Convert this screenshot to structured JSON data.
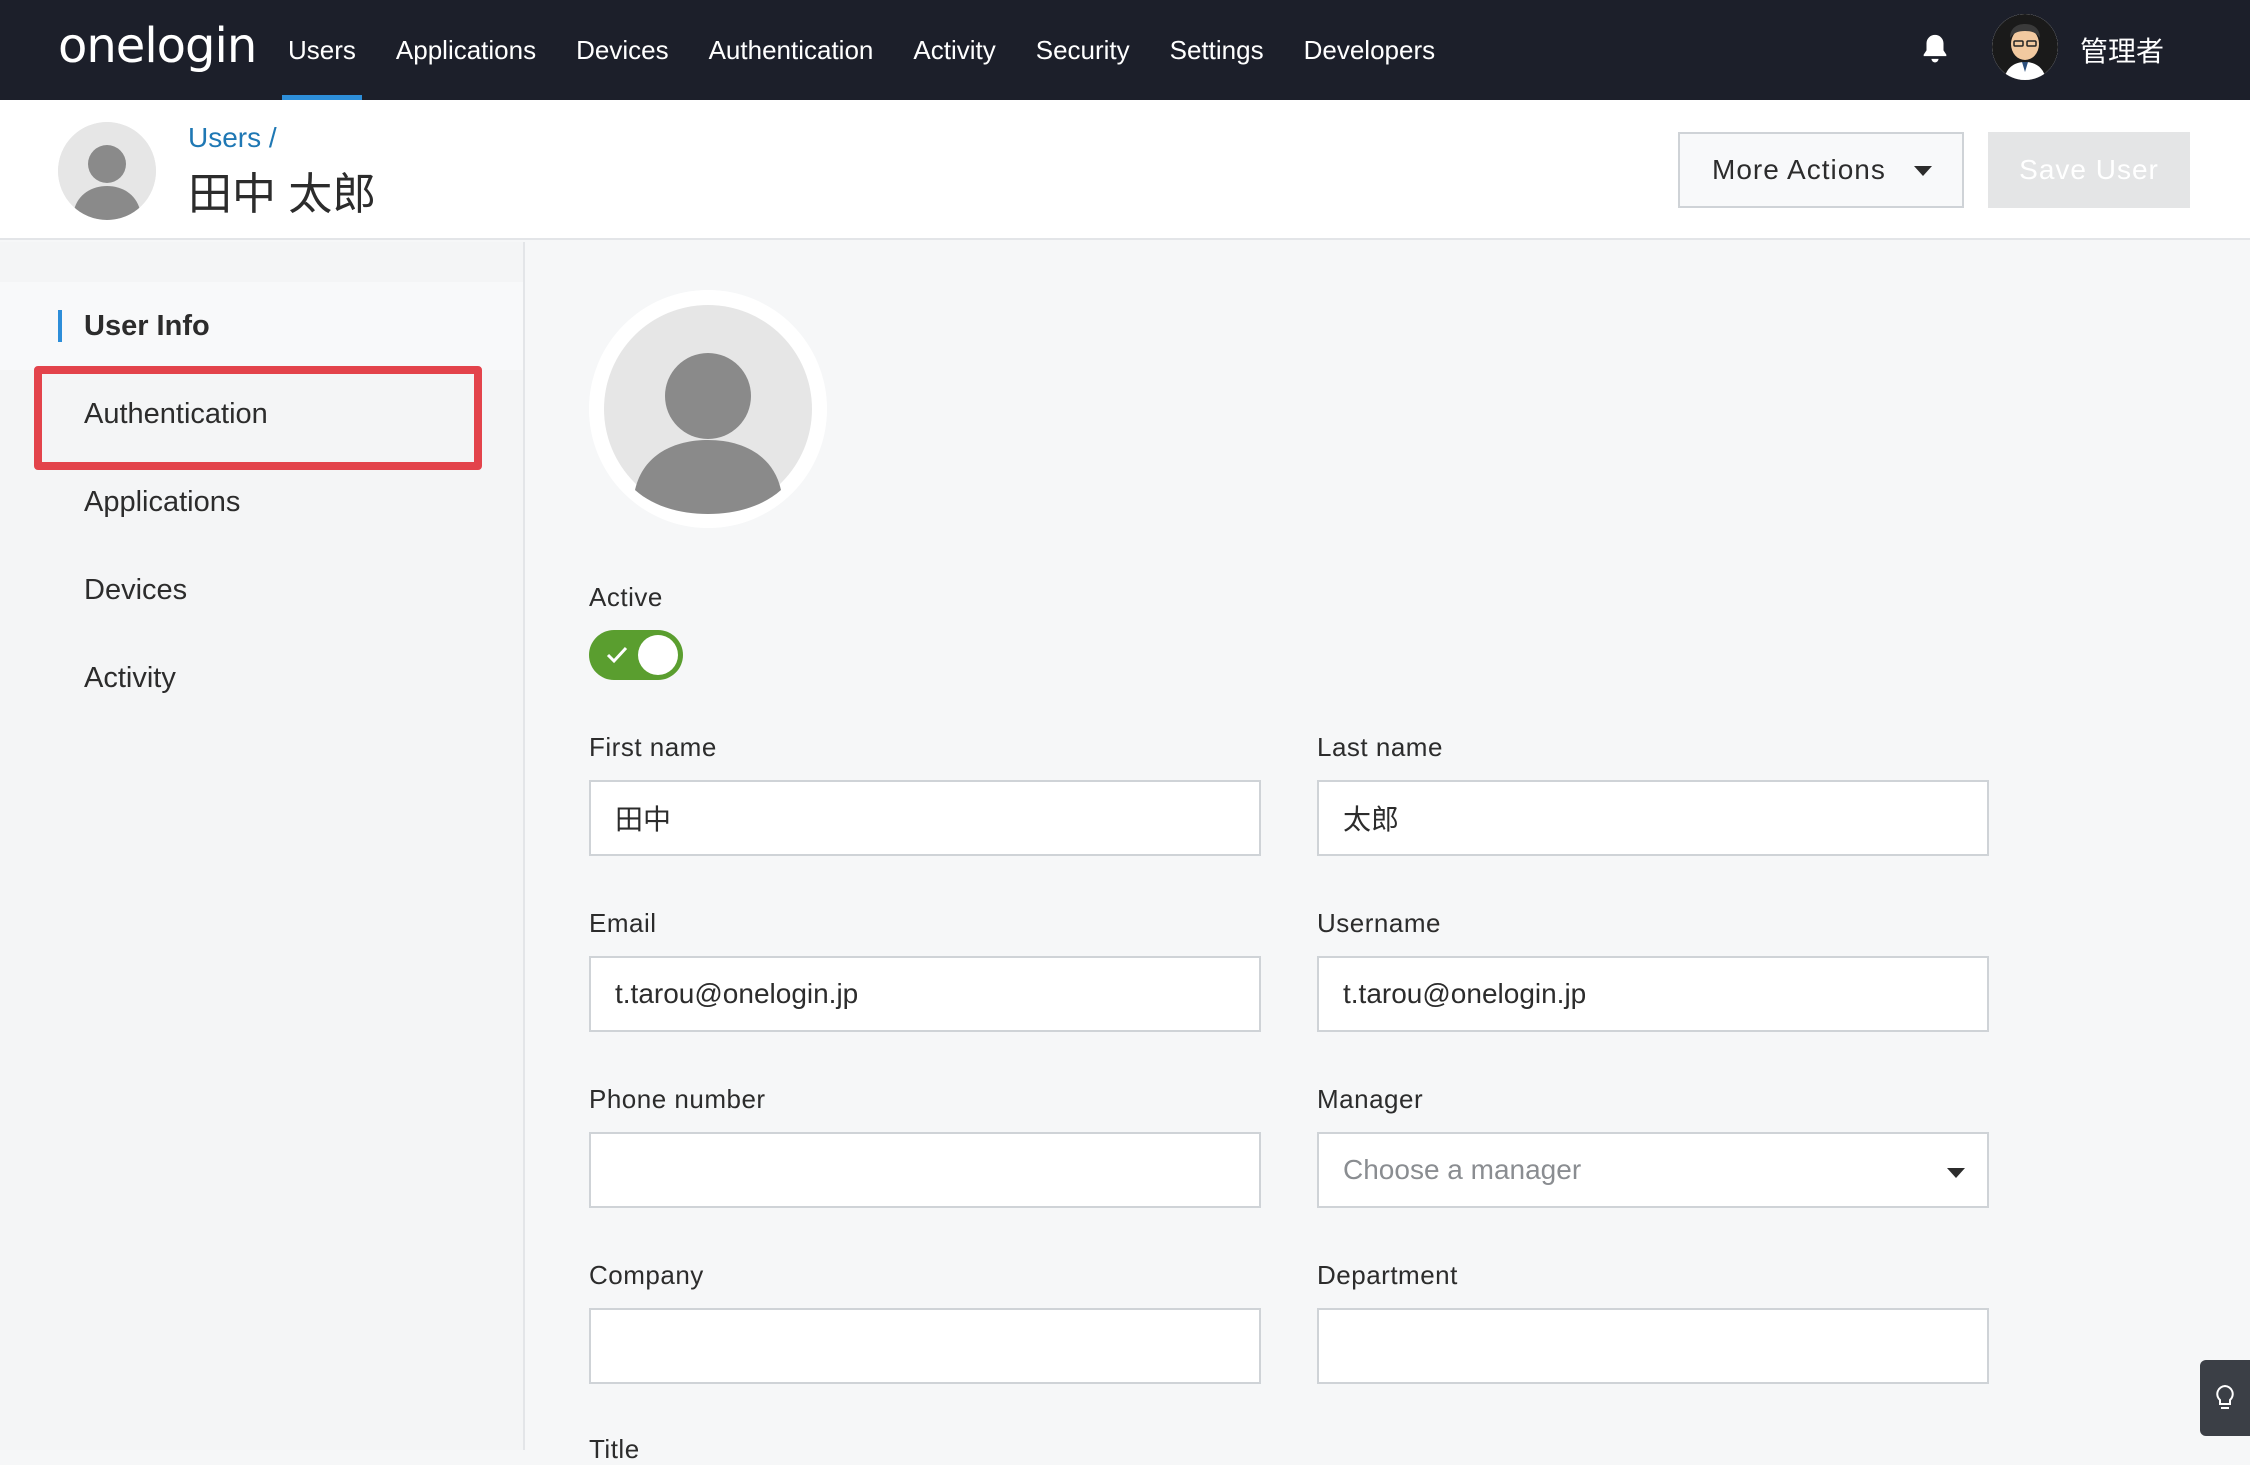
{
  "topnav": {
    "logo": "onelogin",
    "items": [
      {
        "label": "Users",
        "active": true
      },
      {
        "label": "Applications"
      },
      {
        "label": "Devices"
      },
      {
        "label": "Authentication"
      },
      {
        "label": "Activity"
      },
      {
        "label": "Security"
      },
      {
        "label": "Settings"
      },
      {
        "label": "Developers"
      }
    ],
    "admin_name": "管理者",
    "icons": {
      "notification": "bell-icon",
      "account": "admin-avatar"
    }
  },
  "header": {
    "breadcrumb": "Users /",
    "title": "田中 太郎",
    "more_actions_label": "More Actions",
    "save_user_label": "Save User"
  },
  "sidebar": {
    "items": [
      {
        "label": "User Info",
        "active": true
      },
      {
        "label": "Authentication",
        "highlighted": true
      },
      {
        "label": "Applications"
      },
      {
        "label": "Devices"
      },
      {
        "label": "Activity"
      }
    ]
  },
  "form": {
    "active_label": "Active",
    "active_on": true,
    "first_name": {
      "label": "First name",
      "value": "田中"
    },
    "last_name": {
      "label": "Last name",
      "value": "太郎"
    },
    "email": {
      "label": "Email",
      "value": "t.tarou@onelogin.jp"
    },
    "username": {
      "label": "Username",
      "value": "t.tarou@onelogin.jp"
    },
    "phone": {
      "label": "Phone number",
      "value": ""
    },
    "manager": {
      "label": "Manager",
      "placeholder": "Choose a manager"
    },
    "company": {
      "label": "Company",
      "value": ""
    },
    "department": {
      "label": "Department",
      "value": ""
    },
    "title": {
      "label": "Title"
    }
  },
  "colors": {
    "nav_bg": "#1c1f2a",
    "accent": "#2d8ed9",
    "toggle_on": "#5a9e2f",
    "highlight": "#e3434b"
  }
}
